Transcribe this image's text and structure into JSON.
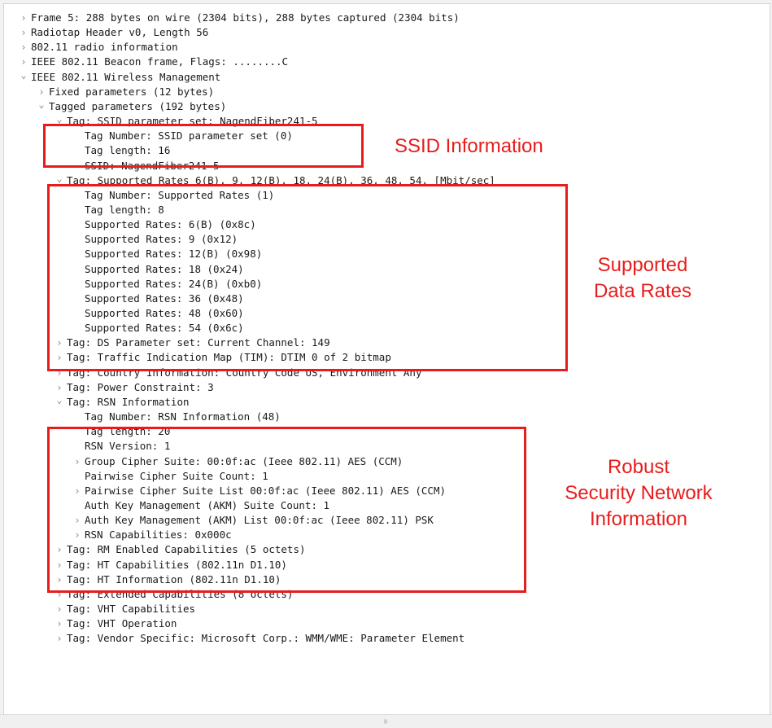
{
  "tree": [
    {
      "indent": 0,
      "chevron": "right",
      "text": "Frame 5: 288 bytes on wire (2304 bits), 288 bytes captured (2304 bits)"
    },
    {
      "indent": 0,
      "chevron": "right",
      "text": "Radiotap Header v0, Length 56"
    },
    {
      "indent": 0,
      "chevron": "right",
      "text": "802.11 radio information"
    },
    {
      "indent": 0,
      "chevron": "right",
      "text": "IEEE 802.11 Beacon frame, Flags: ........C"
    },
    {
      "indent": 0,
      "chevron": "down",
      "text": "IEEE 802.11 Wireless Management"
    },
    {
      "indent": 1,
      "chevron": "right",
      "text": "Fixed parameters (12 bytes)"
    },
    {
      "indent": 1,
      "chevron": "down",
      "text": "Tagged parameters (192 bytes)"
    },
    {
      "indent": 2,
      "chevron": "down",
      "text": "Tag: SSID parameter set: NagendFiber241-5"
    },
    {
      "indent": 3,
      "chevron": "none",
      "text": "Tag Number: SSID parameter set (0)"
    },
    {
      "indent": 3,
      "chevron": "none",
      "text": "Tag length: 16"
    },
    {
      "indent": 3,
      "chevron": "none",
      "text": "SSID: NagendFiber241-5"
    },
    {
      "indent": 2,
      "chevron": "down",
      "text": "Tag: Supported Rates 6(B), 9, 12(B), 18, 24(B), 36, 48, 54, [Mbit/sec]"
    },
    {
      "indent": 3,
      "chevron": "none",
      "text": "Tag Number: Supported Rates (1)"
    },
    {
      "indent": 3,
      "chevron": "none",
      "text": "Tag length: 8"
    },
    {
      "indent": 3,
      "chevron": "none",
      "text": "Supported Rates: 6(B) (0x8c)"
    },
    {
      "indent": 3,
      "chevron": "none",
      "text": "Supported Rates: 9 (0x12)"
    },
    {
      "indent": 3,
      "chevron": "none",
      "text": "Supported Rates: 12(B) (0x98)"
    },
    {
      "indent": 3,
      "chevron": "none",
      "text": "Supported Rates: 18 (0x24)"
    },
    {
      "indent": 3,
      "chevron": "none",
      "text": "Supported Rates: 24(B) (0xb0)"
    },
    {
      "indent": 3,
      "chevron": "none",
      "text": "Supported Rates: 36 (0x48)"
    },
    {
      "indent": 3,
      "chevron": "none",
      "text": "Supported Rates: 48 (0x60)"
    },
    {
      "indent": 3,
      "chevron": "none",
      "text": "Supported Rates: 54 (0x6c)"
    },
    {
      "indent": 2,
      "chevron": "right",
      "text": "Tag: DS Parameter set: Current Channel: 149"
    },
    {
      "indent": 2,
      "chevron": "right",
      "text": "Tag: Traffic Indication Map (TIM): DTIM 0 of 2 bitmap"
    },
    {
      "indent": 2,
      "chevron": "right",
      "text": "Tag: Country Information: Country Code US, Environment Any"
    },
    {
      "indent": 2,
      "chevron": "right",
      "text": "Tag: Power Constraint: 3"
    },
    {
      "indent": 2,
      "chevron": "down",
      "text": "Tag: RSN Information"
    },
    {
      "indent": 3,
      "chevron": "none",
      "text": "Tag Number: RSN Information (48)"
    },
    {
      "indent": 3,
      "chevron": "none",
      "text": "Tag length: 20"
    },
    {
      "indent": 3,
      "chevron": "none",
      "text": "RSN Version: 1"
    },
    {
      "indent": 3,
      "chevron": "right",
      "text": "Group Cipher Suite: 00:0f:ac (Ieee 802.11) AES (CCM)"
    },
    {
      "indent": 3,
      "chevron": "none",
      "text": "Pairwise Cipher Suite Count: 1"
    },
    {
      "indent": 3,
      "chevron": "right",
      "text": "Pairwise Cipher Suite List 00:0f:ac (Ieee 802.11) AES (CCM)"
    },
    {
      "indent": 3,
      "chevron": "none",
      "text": "Auth Key Management (AKM) Suite Count: 1"
    },
    {
      "indent": 3,
      "chevron": "right",
      "text": "Auth Key Management (AKM) List 00:0f:ac (Ieee 802.11) PSK"
    },
    {
      "indent": 3,
      "chevron": "right",
      "text": "RSN Capabilities: 0x000c"
    },
    {
      "indent": 2,
      "chevron": "right",
      "text": "Tag: RM Enabled Capabilities (5 octets)"
    },
    {
      "indent": 2,
      "chevron": "right",
      "text": "Tag: HT Capabilities (802.11n D1.10)"
    },
    {
      "indent": 2,
      "chevron": "right",
      "text": "Tag: HT Information (802.11n D1.10)"
    },
    {
      "indent": 2,
      "chevron": "right",
      "text": "Tag: Extended Capabilities (8 octets)"
    },
    {
      "indent": 2,
      "chevron": "right",
      "text": "Tag: VHT Capabilities"
    },
    {
      "indent": 2,
      "chevron": "right",
      "text": "Tag: VHT Operation"
    },
    {
      "indent": 2,
      "chevron": "right",
      "text": "Tag: Vendor Specific: Microsoft Corp.: WMM/WME: Parameter Element"
    }
  ],
  "annotations": {
    "ssid": {
      "label": "SSID Information"
    },
    "rates": {
      "label": "Supported\nData Rates"
    },
    "rsn": {
      "label": "Robust\nSecurity Network\nInformation"
    }
  },
  "colors": {
    "annotation": "#e81c1c",
    "chevron": "#8a8a8a",
    "text": "#1a1a1a"
  },
  "icons": {
    "collapsed": "chevron-right-icon",
    "expanded": "chevron-down-icon"
  }
}
